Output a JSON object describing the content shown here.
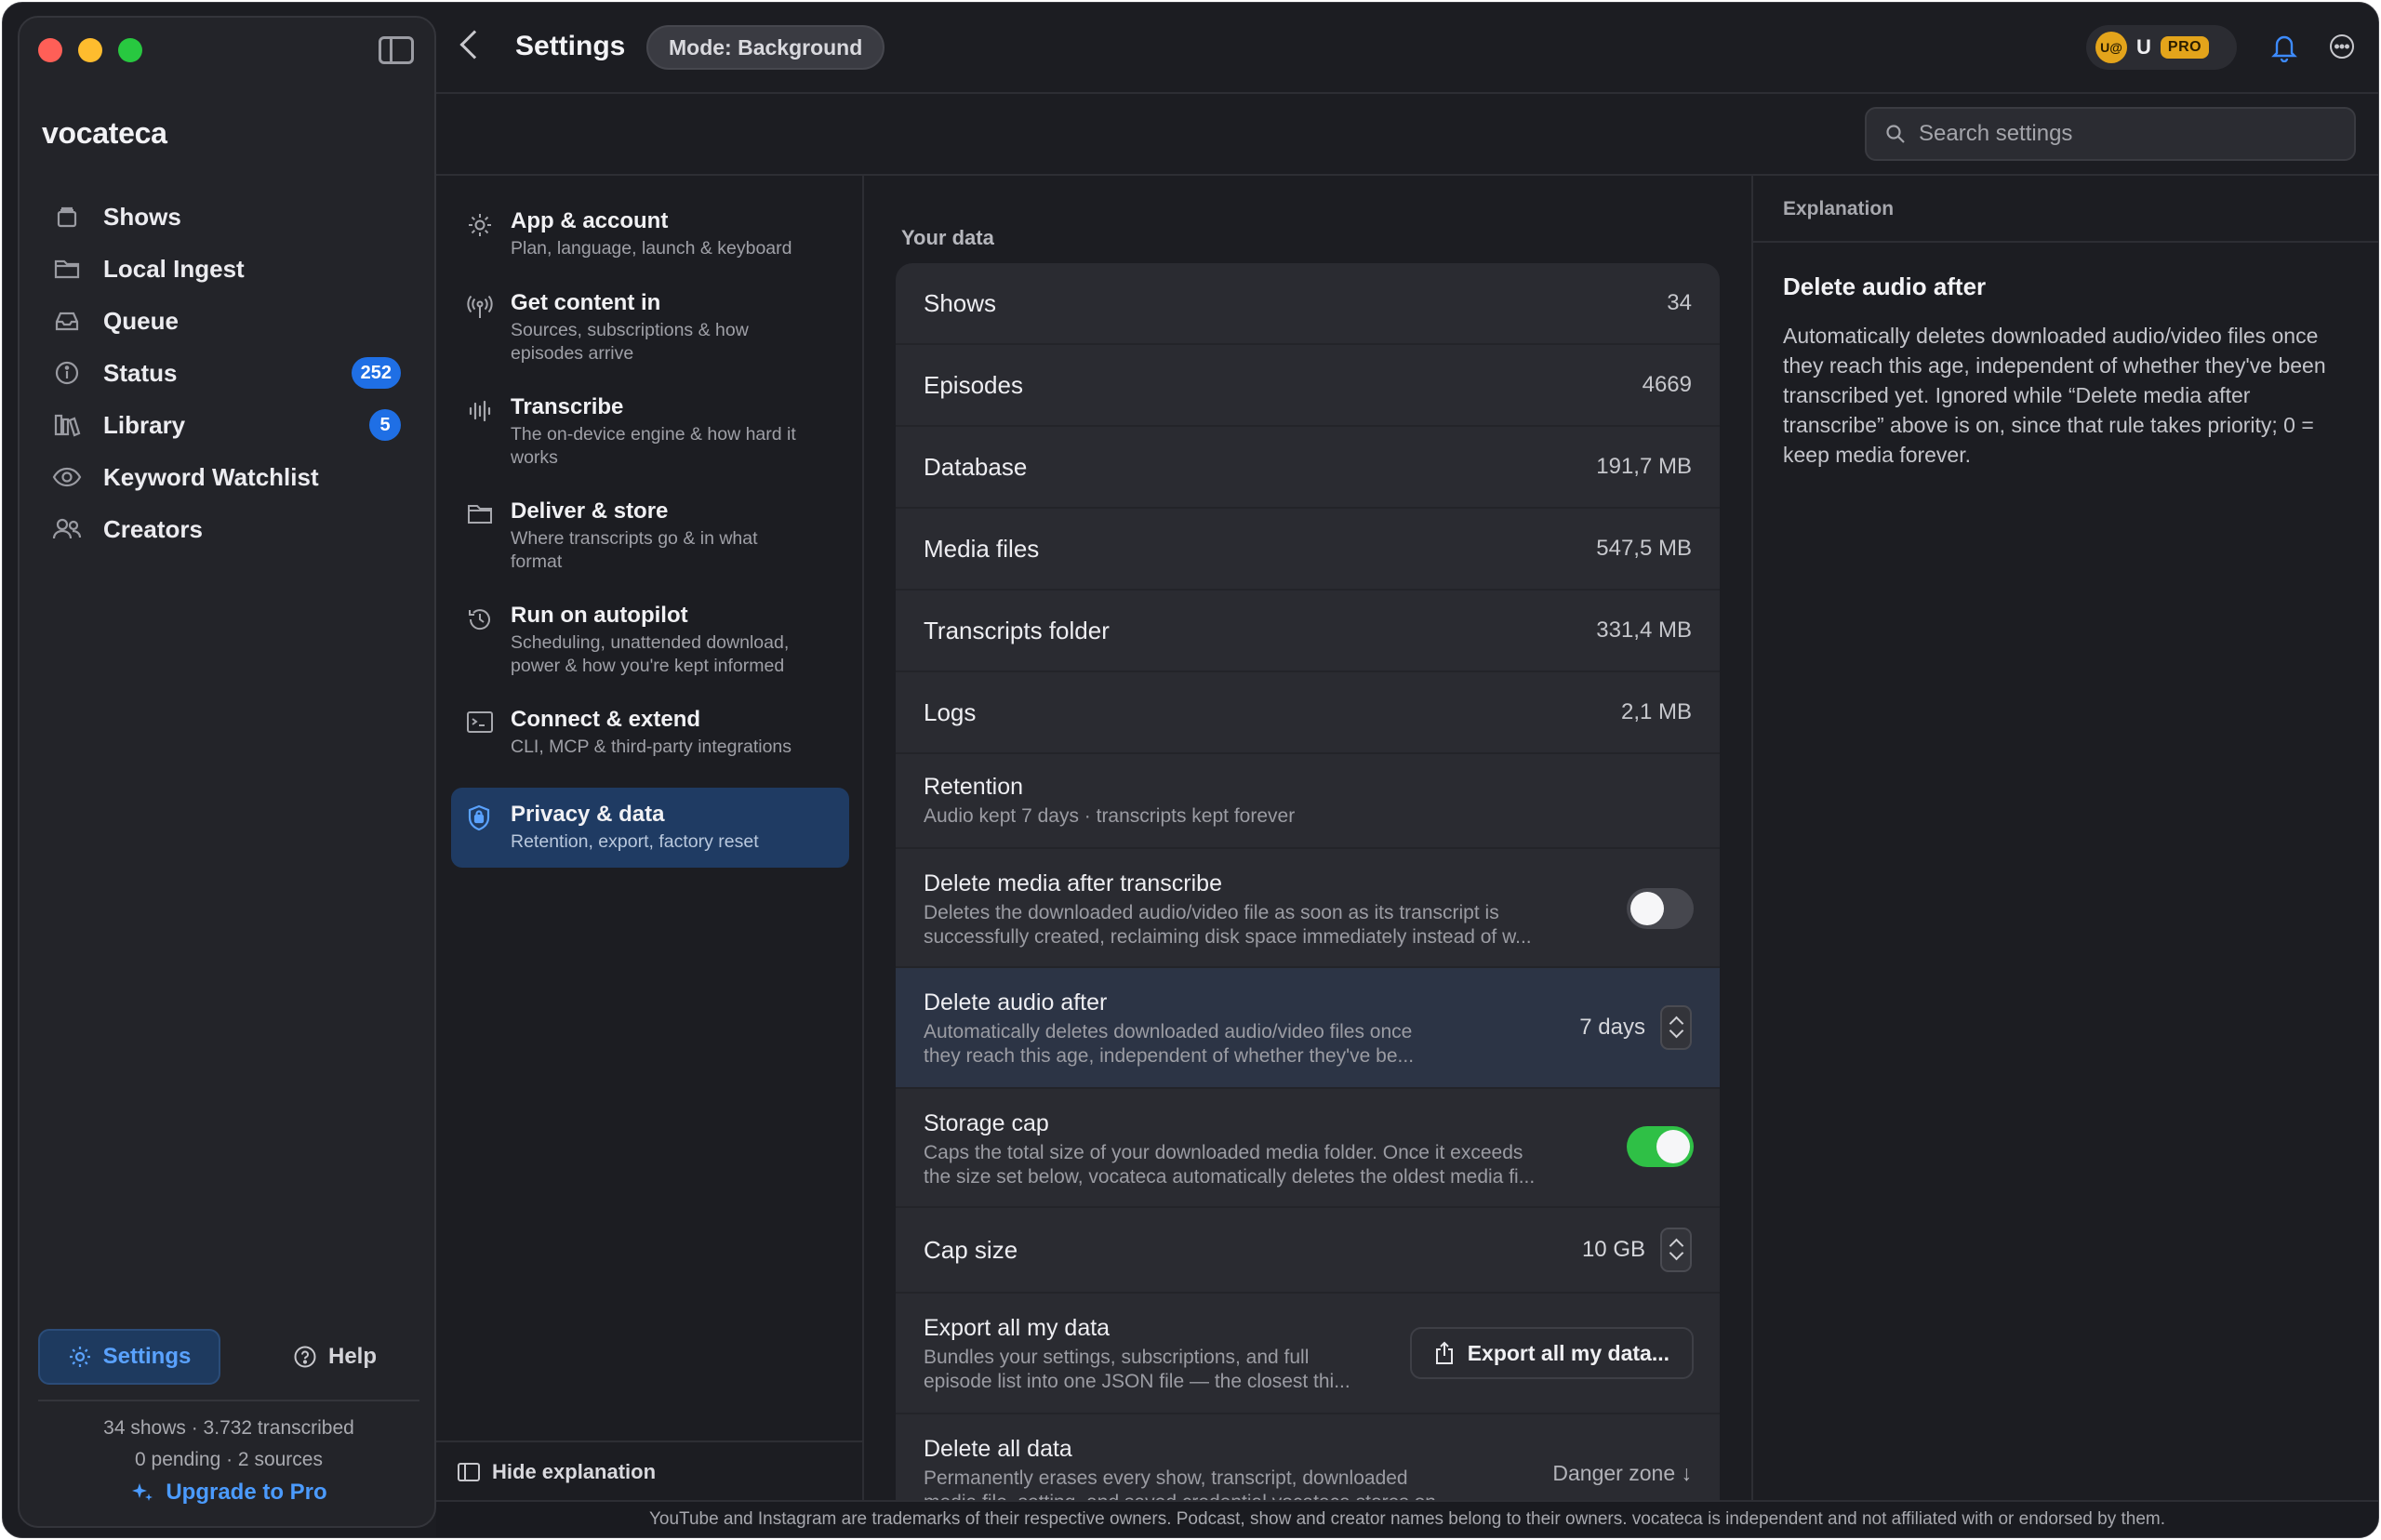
{
  "app": {
    "name": "vocateca"
  },
  "sidebar": {
    "items": [
      {
        "label": "Shows",
        "icon": "stack-icon",
        "badge": null
      },
      {
        "label": "Local Ingest",
        "icon": "folder-icon",
        "badge": null
      },
      {
        "label": "Queue",
        "icon": "inbox-tray-icon",
        "badge": null
      },
      {
        "label": "Status",
        "icon": "info-circle-icon",
        "badge": "252"
      },
      {
        "label": "Library",
        "icon": "books-icon",
        "badge": "5"
      },
      {
        "label": "Keyword Watchlist",
        "icon": "eye-icon",
        "badge": null
      },
      {
        "label": "Creators",
        "icon": "people-icon",
        "badge": null
      }
    ],
    "settings_label": "Settings",
    "help_label": "Help",
    "stats_line1": "34 shows · 3.732 transcribed",
    "stats_line2": "0 pending · 2 sources",
    "upgrade_label": "Upgrade to Pro"
  },
  "header": {
    "title": "Settings",
    "mode_label": "Mode: Background",
    "user_avatar": "U@",
    "user_initial": "U",
    "plan_badge": "PRO"
  },
  "search": {
    "placeholder": "Search settings"
  },
  "settings_nav": [
    {
      "title": "App & account",
      "subtitle": "Plan, language, launch & keyboard",
      "icon": "gear-icon",
      "active": false
    },
    {
      "title": "Get content in",
      "subtitle": "Sources, subscriptions & how episodes arrive",
      "icon": "antenna-icon",
      "active": false
    },
    {
      "title": "Transcribe",
      "subtitle": "The on-device engine & how hard it works",
      "icon": "waveform-icon",
      "active": false
    },
    {
      "title": "Deliver & store",
      "subtitle": "Where transcripts go & in what format",
      "icon": "folder-icon",
      "active": false
    },
    {
      "title": "Run on autopilot",
      "subtitle": "Scheduling, unattended download, power & how you're kept informed",
      "icon": "clock-history-icon",
      "active": false
    },
    {
      "title": "Connect & extend",
      "subtitle": "CLI, MCP & third-party integrations",
      "icon": "terminal-icon",
      "active": false
    },
    {
      "title": "Privacy & data",
      "subtitle": "Retention, export, factory reset",
      "icon": "shield-icon",
      "active": true
    }
  ],
  "hide_explanation_label": "Hide explanation",
  "main": {
    "section_label": "Your data",
    "stats": [
      {
        "label": "Shows",
        "value": "34"
      },
      {
        "label": "Episodes",
        "value": "4669"
      },
      {
        "label": "Database",
        "value": "191,7 MB"
      },
      {
        "label": "Media files",
        "value": "547,5 MB"
      },
      {
        "label": "Transcripts folder",
        "value": "331,4 MB"
      },
      {
        "label": "Logs",
        "value": "2,1 MB"
      }
    ],
    "retention": {
      "label": "Retention",
      "desc": "Audio kept 7 days · transcripts kept forever"
    },
    "delete_media": {
      "label": "Delete media after transcribe",
      "desc1": "Deletes the downloaded audio/video file as soon as its transcript is",
      "desc2": "successfully created, reclaiming disk space immediately instead of w...",
      "enabled": false
    },
    "delete_audio": {
      "label": "Delete audio after",
      "desc1": "Automatically deletes downloaded audio/video files once",
      "desc2": "they reach this age, independent of whether they've be...",
      "value": "7 days"
    },
    "storage_cap": {
      "label": "Storage cap",
      "desc1": "Caps the total size of your downloaded media folder. Once it exceeds",
      "desc2": "the size set below, vocateca automatically deletes the oldest media fi...",
      "enabled": true
    },
    "cap_size": {
      "label": "Cap size",
      "value": "10 GB"
    },
    "export": {
      "label": "Export all my data",
      "desc1": "Bundles your settings, subscriptions, and full",
      "desc2": "episode list into one JSON file — the closest thi...",
      "button_label": "Export all my data..."
    },
    "delete_all": {
      "label": "Delete all data",
      "desc1": "Permanently erases every show, transcript, downloaded",
      "desc2": "media file, setting, and saved credential vocateca stores on...",
      "danger_label": "Danger zone ↓"
    }
  },
  "explanation": {
    "header": "Explanation",
    "title": "Delete audio after",
    "body": "Automatically deletes downloaded audio/video files once they reach this age, independent of whether they've been transcribed yet. Ignored while “Delete media after transcribe” above is on, since that rule takes priority; 0 = keep media forever."
  },
  "footer": {
    "text": "YouTube and Instagram are trademarks of their respective owners. Podcast, show and creator names belong to their owners. vocateca is independent and not affiliated with or endorsed by them."
  },
  "colors": {
    "accent": "#1f6fe5",
    "link": "#4b9bff",
    "pro": "#e3a41b",
    "toggle_on": "#2fc046"
  }
}
